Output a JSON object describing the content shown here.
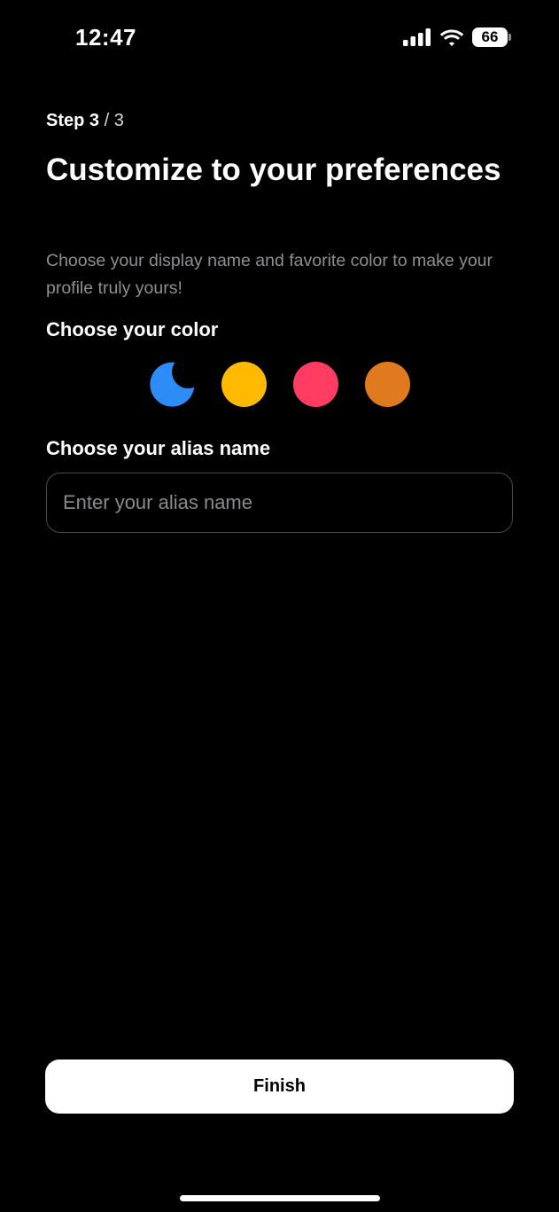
{
  "status_bar": {
    "time": "12:47",
    "battery_level": "66",
    "icons": [
      "signal-bars-icon",
      "wifi-icon",
      "battery-icon"
    ]
  },
  "step": {
    "current": "Step 3",
    "separator": " / ",
    "total": "3"
  },
  "page": {
    "title": "Customize to your preferences",
    "description": "Choose your display name and favorite color to make your profile truly yours!"
  },
  "color_section": {
    "title": "Choose your color",
    "options": [
      {
        "color": "#2E8CF6",
        "icon": "moon-icon",
        "selected": true
      },
      {
        "color": "#FFBA00",
        "icon": null,
        "selected": false
      },
      {
        "color": "#FF3D63",
        "icon": null,
        "selected": false
      },
      {
        "color": "#E07A1F",
        "icon": null,
        "selected": false
      }
    ]
  },
  "alias_section": {
    "title": "Choose your alias name",
    "input_placeholder": "Enter your alias name",
    "input_value": ""
  },
  "actions": {
    "finish_label": "Finish"
  },
  "colors": {
    "background": "#000000",
    "text_primary": "#FFFFFF",
    "text_secondary": "#8E8E93",
    "button_background": "#FFFFFF",
    "button_text": "#000000"
  }
}
